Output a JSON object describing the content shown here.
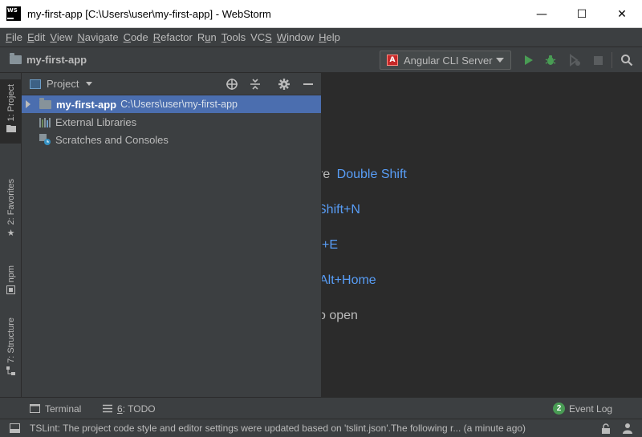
{
  "window": {
    "logo_text": "WS",
    "title": "my-first-app [C:\\Users\\user\\my-first-app] - WebStorm",
    "minimize_symbol": "—",
    "maximize_symbol": "☐",
    "close_symbol": "✕"
  },
  "menu": {
    "items": [
      {
        "u": "F",
        "rest": "ile"
      },
      {
        "u": "E",
        "rest": "dit"
      },
      {
        "u": "V",
        "rest": "iew"
      },
      {
        "u": "N",
        "rest": "avigate"
      },
      {
        "u": "C",
        "rest": "ode"
      },
      {
        "u": "R",
        "rest": "efactor"
      },
      {
        "pre": "R",
        "u": "u",
        "rest": "n"
      },
      {
        "u": "T",
        "rest": "ools"
      },
      {
        "pre": "VC",
        "u": "S",
        "rest": ""
      },
      {
        "u": "W",
        "rest": "indow"
      },
      {
        "u": "H",
        "rest": "elp"
      }
    ]
  },
  "navbar": {
    "project_name": "my-first-app",
    "run_config_label": "Angular CLI Server",
    "run_config_icon": "A"
  },
  "left_strip": {
    "project_tab": "1: Project",
    "favorites_tab": "2: Favorites",
    "npm_tab": "npm",
    "structure_tab": "7: Structure"
  },
  "project_panel": {
    "title": "Project",
    "tree": {
      "root_name": "my-first-app",
      "root_path": "C:\\Users\\user\\my-first-app",
      "external_libraries": "External Libraries",
      "scratches": "Scratches and Consoles"
    }
  },
  "editor": {
    "hints": [
      {
        "text": "re ",
        "key": "Double Shift"
      },
      {
        "text": "",
        "key": "Shift+N"
      },
      {
        "text": "",
        "key": "+E"
      },
      {
        "text": "",
        "key": "Alt+Home"
      },
      {
        "text": "o open",
        "key": ""
      }
    ]
  },
  "bottom_bar": {
    "terminal": "Terminal",
    "todo_prefix": "6",
    "todo_label": ": TODO",
    "event_log_count": "2",
    "event_log": "Event Log"
  },
  "status_bar": {
    "message": "TSLint: The project code style and editor settings were updated based on 'tslint.json'.The following r... (a minute ago)"
  },
  "colors": {
    "accent_blue": "#589df6",
    "selection": "#4b6eaf",
    "run_green": "#499c54",
    "angular_red": "#c62828"
  }
}
